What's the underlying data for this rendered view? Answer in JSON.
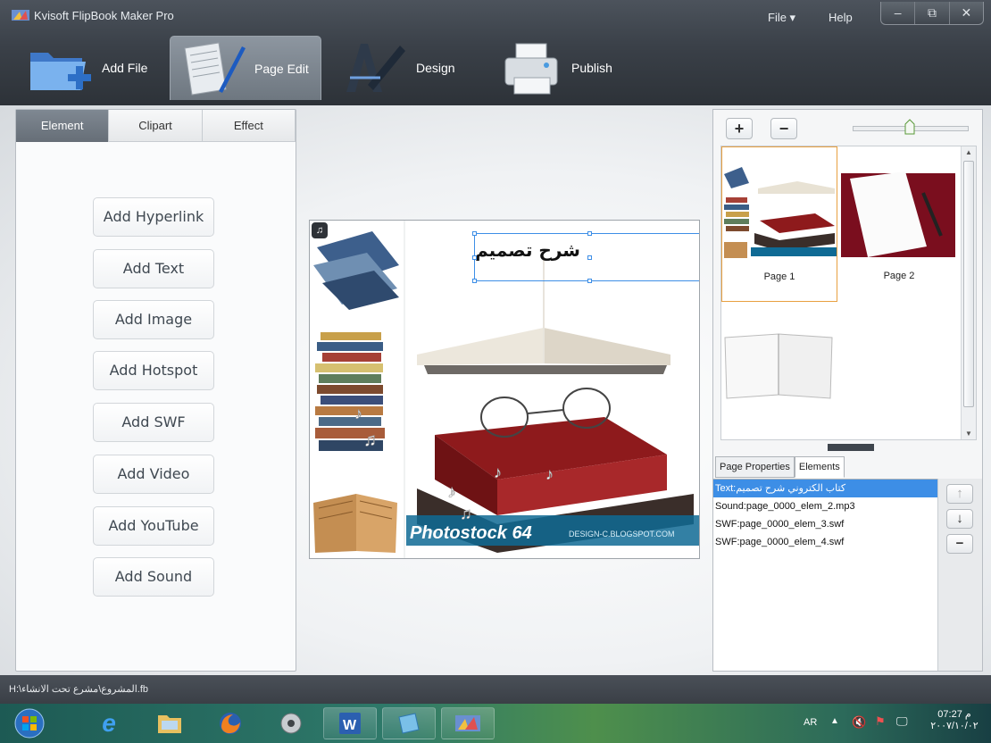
{
  "window": {
    "title": "Kvisoft FlipBook Maker Pro",
    "menu": {
      "file": "File ▾",
      "help": "Help"
    },
    "controls": {
      "minimize": "–",
      "maximize": "⧉",
      "close": "✕"
    }
  },
  "toolbar": {
    "add_file": "Add File",
    "page_edit": "Page Edit",
    "design": "Design",
    "publish": "Publish"
  },
  "left_panel": {
    "tabs": [
      "Element",
      "Clipart",
      "Effect"
    ],
    "active_tab": "Element",
    "buttons": [
      "Add Hyperlink",
      "Add Text",
      "Add Image",
      "Add Hotspot",
      "Add SWF",
      "Add Video",
      "Add YouTube",
      "Add Sound"
    ]
  },
  "canvas": {
    "text_element": "شرح تصميم",
    "watermark": "Photostock 64",
    "watermark_url": "DESIGN-C.BLOGSPOT.COM"
  },
  "right_panel": {
    "zoom_in": "+",
    "zoom_out": "−",
    "zoom_level": 0.49,
    "pages": [
      "Page 1",
      "Page 2"
    ],
    "selected_page": "Page 1",
    "prop_tabs": [
      "Page Properties",
      "Elements"
    ],
    "active_prop_tab": "Elements",
    "elements": [
      "Text:كتاب الكتروني شرح تصميم",
      "Sound:page_0000_elem_2.mp3",
      "SWF:page_0000_elem_3.swf",
      "SWF:page_0000_elem_4.swf"
    ],
    "move_up": "↑",
    "move_down": "↓",
    "remove": "−"
  },
  "status": {
    "path": "H:\\المشروع\\مشرع تحت الانشاء.fb"
  },
  "taskbar": {
    "language": "AR",
    "time": "07:27 م",
    "date": "٢٠٠٧/١٠/٠٢"
  },
  "colors": {
    "selection": "#3d8ee6",
    "page_highlight": "#e8a040",
    "header_dark": "#3a4048"
  }
}
